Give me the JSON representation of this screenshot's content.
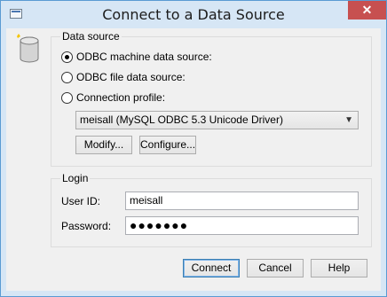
{
  "window": {
    "title": "Connect to a Data Source",
    "close_glyph": "✕",
    "icon": "window-icon"
  },
  "icons": {
    "database": "database-icon"
  },
  "data_source": {
    "group_label": "Data source",
    "options": [
      {
        "label": "ODBC machine data source:",
        "checked": true
      },
      {
        "label": "ODBC file data source:",
        "checked": false
      },
      {
        "label": "Connection profile:",
        "checked": false
      }
    ],
    "selected_source": "meisall (MySQL ODBC 5.3 Unicode Driver)",
    "modify_label": "Modify...",
    "configure_label": "Configure..."
  },
  "login": {
    "group_label": "Login",
    "user_id_label": "User ID:",
    "user_id_value": "meisall",
    "password_label": "Password:",
    "password_value": "●●●●●●●"
  },
  "buttons": {
    "connect": "Connect",
    "cancel": "Cancel",
    "help": "Help"
  },
  "colors": {
    "frame": "#d6e6f5",
    "close_button": "#c75050",
    "default_button_border": "#3c7fb1"
  }
}
